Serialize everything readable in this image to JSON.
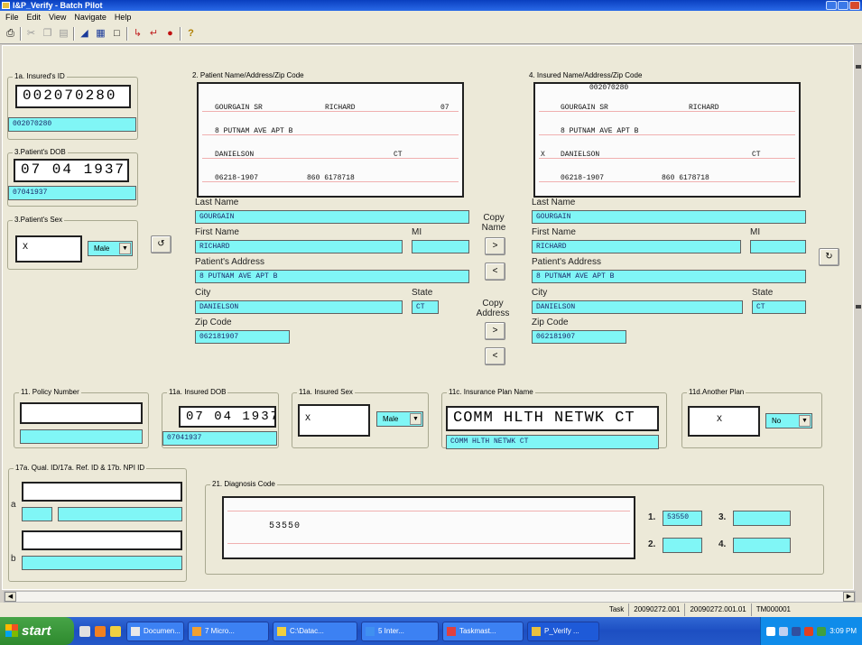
{
  "window": {
    "title": "I&P_Verify - Batch Pilot"
  },
  "menu": [
    "File",
    "Edit",
    "View",
    "Navigate",
    "Help"
  ],
  "toolbar_icons": [
    "print-icon",
    "cut-icon",
    "copy-icon",
    "paste-icon",
    "select-icon",
    "grid-icon",
    "frame-icon",
    "zoom-in-icon",
    "zoom-out-icon",
    "record-icon",
    "help-icon"
  ],
  "insured_id": {
    "label": "1a. Insured's ID",
    "image_text": "002070280",
    "value": "002070280"
  },
  "patient_dob": {
    "label": "3.Patient's DOB",
    "image_text": "07 04 1937",
    "value": "07041937"
  },
  "patient_sex": {
    "label": "3.Patient's Sex",
    "mark": "X",
    "value": "Male"
  },
  "patient": {
    "label": "2. Patient Name/Address/Zip Code",
    "scan": {
      "row1a": "GOURGAIN SR",
      "row1b": "RICHARD",
      "row1c": "07",
      "row2": "8 PUTNAM AVE APT B",
      "row3a": "DANIELSON",
      "row3b": "CT",
      "row4a": "06218-1907",
      "row4b": "860 6178718"
    },
    "last_name_label": "Last Name",
    "last_name": "GOURGAIN",
    "first_name_label": "First Name",
    "first_name": "RICHARD",
    "mi_label": "MI",
    "mi": "",
    "address_label": "Patient's Address",
    "address": "8 PUTNAM AVE APT B",
    "city_label": "City",
    "city": "DANIELSON",
    "state_label": "State",
    "state": "CT",
    "zip_label": "Zip Code",
    "zip": "062181907"
  },
  "copy": {
    "name_label": "Copy Name",
    "address_label": "Copy Address",
    "right": ">",
    "left": "<"
  },
  "insured": {
    "label": "4. Insured Name/Address/Zip Code",
    "scan": {
      "row0": "002070280",
      "row1a": "GOURGAIN SR",
      "row1b": "RICHARD",
      "row2": "8 PUTNAM AVE APT B",
      "row3x": "X",
      "row3a": "DANIELSON",
      "row3b": "CT",
      "row4a": "06218-1907",
      "row4b": "860 6178718"
    },
    "last_name_label": "Last Name",
    "last_name": "GOURGAIN",
    "first_name_label": "First Name",
    "first_name": "RICHARD",
    "mi_label": "MI",
    "mi": "",
    "address_label": "Patient's Address",
    "address": "8 PUTNAM AVE APT B",
    "city_label": "City",
    "city": "DANIELSON",
    "state_label": "State",
    "state": "CT",
    "zip_label": "Zip Code",
    "zip": "062181907"
  },
  "policy": {
    "label": "11. Policy Number",
    "value": ""
  },
  "insured_dob": {
    "label": "11a. Insured DOB",
    "image_text": "07 04 1937",
    "value": "07041937"
  },
  "insured_sex": {
    "label": "11a. Insured Sex",
    "mark": "X",
    "value": "Male"
  },
  "plan_name": {
    "label": "11c. Insurance Plan Name",
    "image_text": "COMM HLTH NETWK CT",
    "value": "COMM HLTH NETWK CT"
  },
  "another_plan": {
    "label": "11d.Another Plan",
    "mark": "X",
    "value": "No"
  },
  "qual": {
    "label": "17a. Qual. ID/17a. Ref. ID & 17b. NPI ID",
    "a": "a",
    "b": "b"
  },
  "diagnosis": {
    "label": "21. Diagnosis Code",
    "image_text": "53550",
    "d1_label": "1.",
    "d1": "53550",
    "d2_label": "2.",
    "d2": "",
    "d3_label": "3.",
    "d3": "",
    "d4_label": "4.",
    "d4": ""
  },
  "status": {
    "task_label": "Task",
    "batch": "20090272.001",
    "doc": "20090272.001.01",
    "id": "TM000001"
  },
  "taskbar": {
    "start": "start",
    "tasks": [
      "Documen...",
      "7 Micro...",
      "C:\\Datac...",
      "5 Inter...",
      "Taskmast...",
      "P_Verify ..."
    ],
    "clock": "3:09 PM"
  }
}
